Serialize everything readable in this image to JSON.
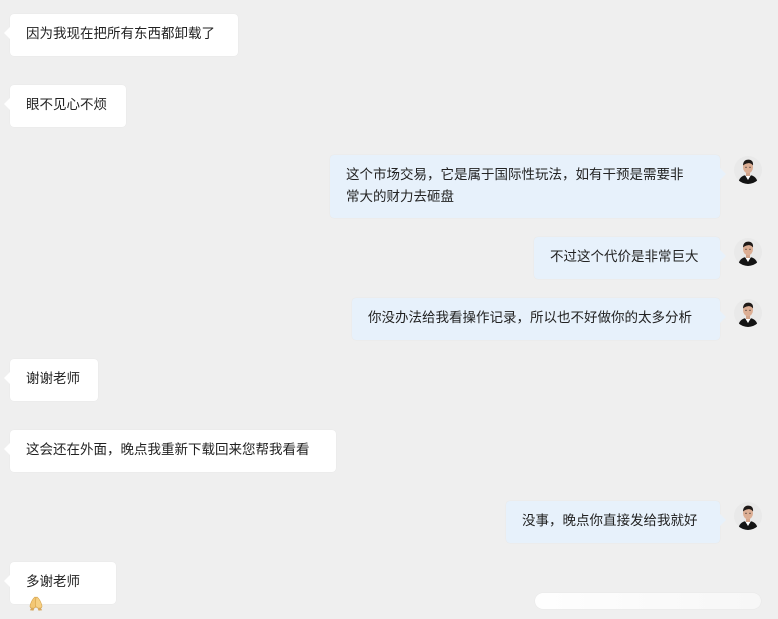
{
  "messages": [
    {
      "side": "incoming",
      "text": "因为我现在把所有东西都卸载了"
    },
    {
      "side": "incoming",
      "text": "眼不见心不烦"
    },
    {
      "side": "outgoing",
      "lines": [
        "这个市场交易，它是属于国际性玩法，如有干预是需要非",
        "常大的财力去砸盘"
      ]
    },
    {
      "side": "outgoing",
      "text": "不过这个代价是非常巨大"
    },
    {
      "side": "outgoing",
      "text": "你没办法给我看操作记录，所以也不好做你的太多分析"
    },
    {
      "side": "incoming",
      "text": "谢谢老师"
    },
    {
      "side": "incoming",
      "text": "这会还在外面，晚点我重新下载回来您帮我看看"
    },
    {
      "side": "outgoing",
      "text": "没事，晚点你直接发给我就好"
    },
    {
      "side": "incoming",
      "text": "多谢老师",
      "emoji": "folded-hands-emoji"
    }
  ],
  "colors": {
    "background": "#efefef",
    "incoming_bubble": "#ffffff",
    "outgoing_bubble": "#e7f1fb"
  },
  "icons": {
    "avatar": "user-avatar-photo",
    "scroll": "scroll-indicator"
  }
}
